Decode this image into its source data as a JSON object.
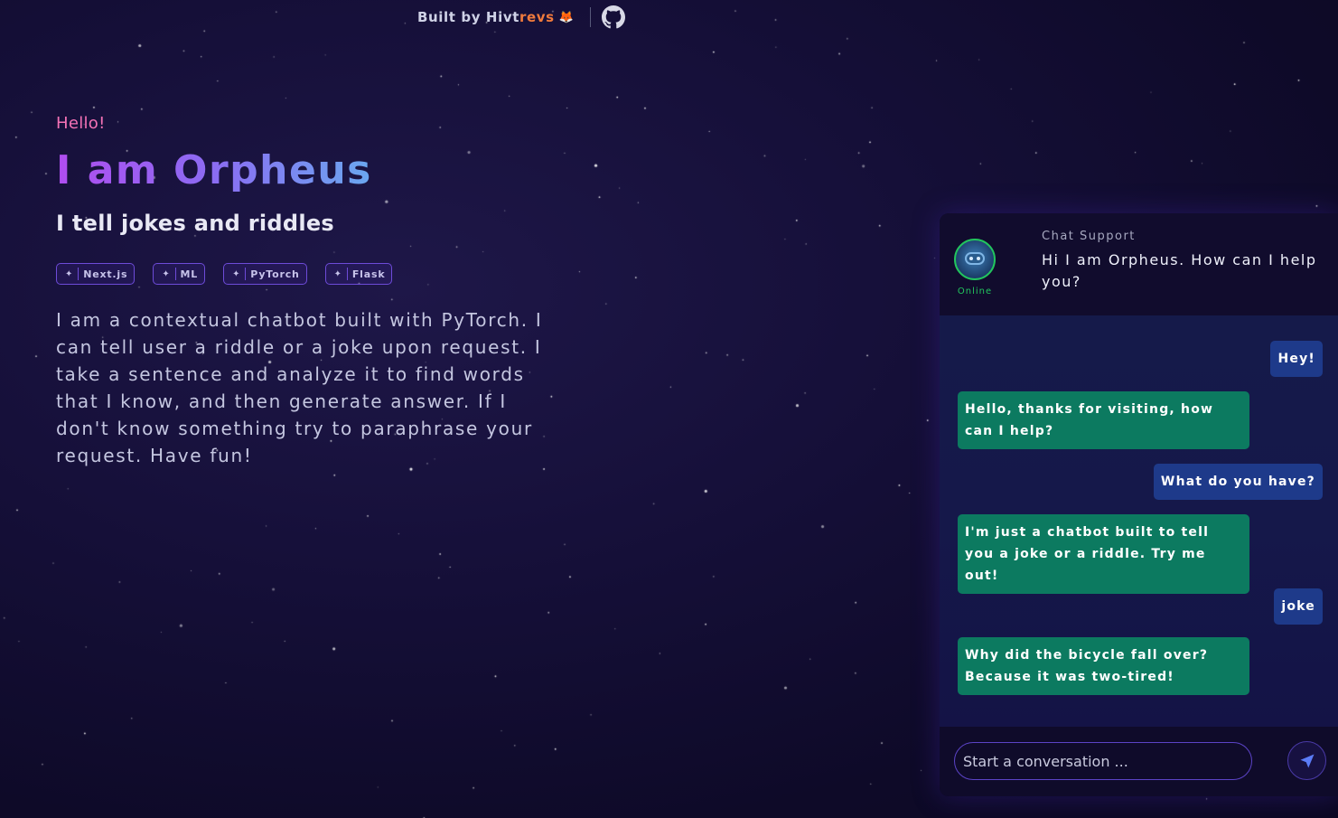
{
  "topbar": {
    "credit_prefix": "Built by Hivt",
    "credit_accent": "revs",
    "fox_emoji": "🦊",
    "github_icon": "github-icon"
  },
  "hero": {
    "hello": "Hello!",
    "name": "I am Orpheus",
    "tagline": "I tell jokes and riddles",
    "badges": [
      "Next.js",
      "ML",
      "PyTorch",
      "Flask"
    ],
    "description": "I am a contextual chatbot built with PyTorch. I can tell user a riddle or a joke upon request. I take a sentence and analyze it to find words that I know, and then generate answer. If I don't know something try to paraphrase your request. Have fun!"
  },
  "chat": {
    "status": "Online",
    "title": "Chat Support",
    "greeting": "Hi I am Orpheus. How can I help you?",
    "messages": [
      {
        "from": "user",
        "text": "Hey!"
      },
      {
        "from": "bot",
        "text": "Hello, thanks for visiting, how can I help?"
      },
      {
        "from": "user",
        "text": "What do you have?"
      },
      {
        "from": "bot",
        "text": "I'm just a chatbot built to tell you a joke or a riddle. Try me out!"
      },
      {
        "from": "user",
        "text": "joke"
      },
      {
        "from": "bot",
        "text": "Why did the bicycle fall over? Because it was two-tired!"
      }
    ],
    "input_placeholder": "Start a conversation ...",
    "input_value": ""
  },
  "colors": {
    "accent_pink": "#f472b6",
    "online_green": "#22c55e",
    "user_bubble": "#1e3a8a",
    "bot_bubble": "#0c7a60",
    "credit_orange": "#f07a3c"
  }
}
